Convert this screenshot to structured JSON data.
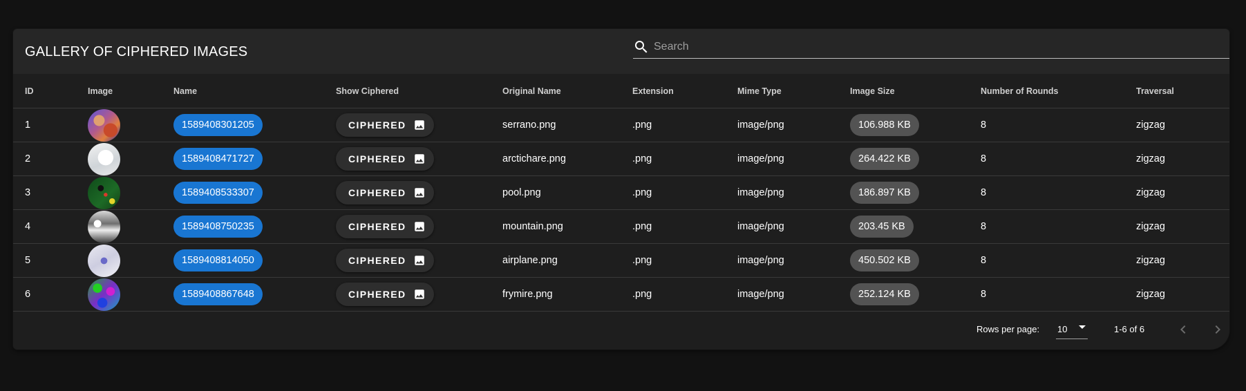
{
  "title": "GALLERY OF CIPHERED IMAGES",
  "search": {
    "placeholder": "Search",
    "icon": "search-icon"
  },
  "columns": [
    "ID",
    "Image",
    "Name",
    "Show Ciphered",
    "Original Name",
    "Extension",
    "Mime Type",
    "Image Size",
    "Number of Rounds",
    "Traversal"
  ],
  "rows": [
    {
      "id": "1",
      "name": "1589408301205",
      "button": "CIPHERED",
      "original": "serrano.png",
      "ext": ".png",
      "mime": "image/png",
      "size": "106.988 KB",
      "rounds": "8",
      "traversal": "zigzag"
    },
    {
      "id": "2",
      "name": "1589408471727",
      "button": "CIPHERED",
      "original": "arctichare.png",
      "ext": ".png",
      "mime": "image/png",
      "size": "264.422 KB",
      "rounds": "8",
      "traversal": "zigzag"
    },
    {
      "id": "3",
      "name": "1589408533307",
      "button": "CIPHERED",
      "original": "pool.png",
      "ext": ".png",
      "mime": "image/png",
      "size": "186.897 KB",
      "rounds": "8",
      "traversal": "zigzag"
    },
    {
      "id": "4",
      "name": "1589408750235",
      "button": "CIPHERED",
      "original": "mountain.png",
      "ext": ".png",
      "mime": "image/png",
      "size": "203.45 KB",
      "rounds": "8",
      "traversal": "zigzag"
    },
    {
      "id": "5",
      "name": "1589408814050",
      "button": "CIPHERED",
      "original": "airplane.png",
      "ext": ".png",
      "mime": "image/png",
      "size": "450.502 KB",
      "rounds": "8",
      "traversal": "zigzag"
    },
    {
      "id": "6",
      "name": "1589408867648",
      "button": "CIPHERED",
      "original": "frymire.png",
      "ext": ".png",
      "mime": "image/png",
      "size": "252.124 KB",
      "rounds": "8",
      "traversal": "zigzag"
    }
  ],
  "pagination": {
    "rows_label": "Rows per page:",
    "rows_value": "10",
    "range": "1-6 of 6"
  },
  "colors": {
    "background": "#121212",
    "card": "#1e1e1e",
    "name_chip": "#1976d2",
    "size_chip": "#535353"
  }
}
